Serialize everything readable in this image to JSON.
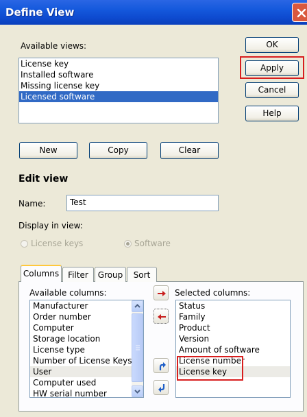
{
  "dialog": {
    "title": "Define View"
  },
  "available_views": {
    "label": "Available views:",
    "items": [
      "License key",
      "Installed software",
      "Missing license key",
      "Licensed software"
    ],
    "selected": "Licensed software"
  },
  "side_buttons": {
    "ok": "OK",
    "apply": "Apply",
    "cancel": "Cancel",
    "help": "Help"
  },
  "view_buttons": {
    "new": "New",
    "copy": "Copy",
    "clear": "Clear"
  },
  "edit_view": {
    "heading": "Edit view",
    "name_label": "Name:",
    "name_value": "Test",
    "display_label": "Display in view:",
    "radio_license_keys": "License keys",
    "radio_software": "Software",
    "selected_radio": "Software"
  },
  "tabs": {
    "items": [
      "Columns",
      "Filter",
      "Group",
      "Sort"
    ],
    "active": "Columns"
  },
  "columns": {
    "available_label": "Available columns:",
    "available_items": [
      "Manufacturer",
      "Order number",
      "Computer",
      "Storage location",
      "License type",
      "Number of License Keys",
      "User",
      "Computer used",
      "HW serial number"
    ],
    "selected_label": "Selected columns:",
    "selected_items": [
      "Status",
      "Family",
      "Product",
      "Version",
      "Amount of software",
      "License number",
      "License key"
    ]
  },
  "colors": {
    "titlebar": "#0e4bd0",
    "selection": "#316ac5",
    "highlight_box": "#d81e1e",
    "add_arrow": "#c81e1e",
    "move_arrow": "#1f5fc8"
  }
}
